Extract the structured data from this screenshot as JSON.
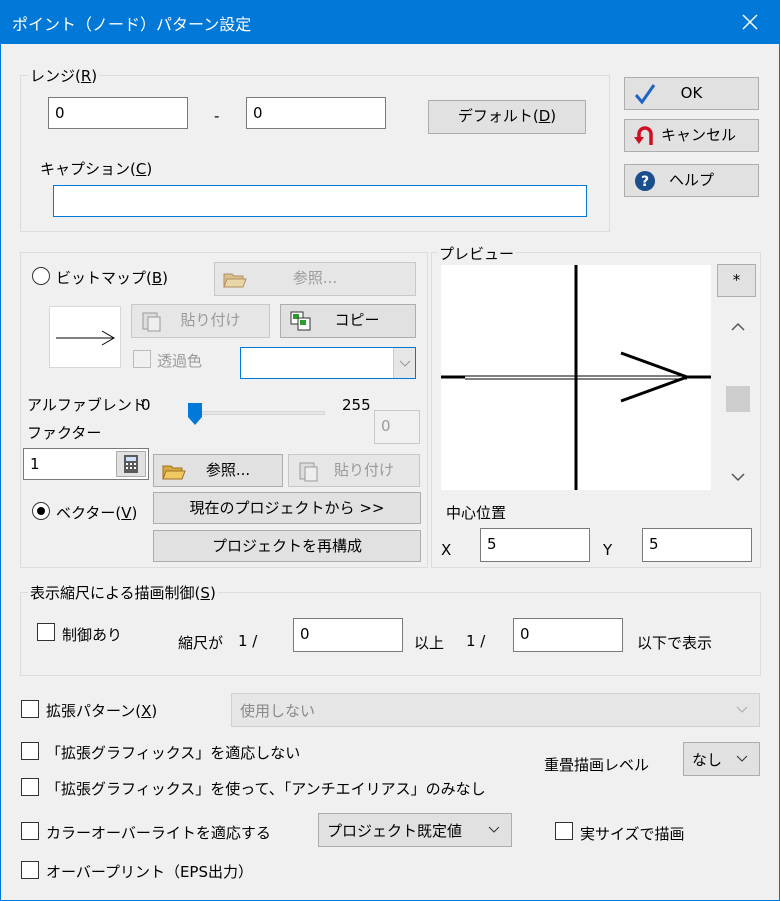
{
  "window": {
    "title": "ポイント（ノード）パターン設定"
  },
  "range": {
    "label": "レンジ(",
    "accel": "R",
    "label_end": ")",
    "from": "0",
    "dash": "-",
    "to": "0",
    "default_prefix": "デフォルト(",
    "default_accel": "D",
    "default_suffix": ")"
  },
  "caption": {
    "label": "キャプション(",
    "accel": "C",
    "label_end": ")",
    "value": ""
  },
  "actions": {
    "ok": "OK",
    "cancel": "キャンセル",
    "help": "ヘルプ"
  },
  "bitmap": {
    "radio_label": "ビットマップ(",
    "radio_accel": "B",
    "radio_end": ")",
    "browse": "参照...",
    "paste": "貼り付け",
    "copy": "コピー",
    "transparent": "透過色"
  },
  "alpha": {
    "label1": "アルファブレンド",
    "label2": "ファクター",
    "min": "0",
    "max": "255",
    "value_box": "0",
    "value": 0,
    "factor": "1"
  },
  "vector": {
    "browse": "参照...",
    "paste": "貼り付け",
    "radio_label": "ベクター(",
    "radio_accel": "V",
    "radio_end": ")",
    "from_project": "現在のプロジェクトから >>",
    "rebuild": "プロジェクトを再構成"
  },
  "preview": {
    "label": "プレビュー",
    "star": "*",
    "center_label": "中心位置",
    "x_label": "X",
    "x_value": "5",
    "y_label": "Y",
    "y_value": "5"
  },
  "scale": {
    "group_label": "表示縮尺による描画制御(",
    "group_accel": "S",
    "group_end": ")",
    "control": "制御あり",
    "ratio_label": "縮尺が",
    "one1": "1 /",
    "v1": "0",
    "above": "以上",
    "one2": "1 /",
    "v2": "0",
    "below": "以下で表示"
  },
  "extended": {
    "label": "拡張パターン(",
    "accel": "X",
    "end": ")",
    "select": "使用しない"
  },
  "graphics": {
    "no_apply": "「拡張グラフィックス」を適応しない",
    "no_antialias": "「拡張グラフィックス」を使って、「アンチエイリアス」のみなし"
  },
  "overlap": {
    "label": "重畳描画レベル",
    "value": "なし"
  },
  "color": {
    "label": "カラーオーバーライトを適応する",
    "value": "プロジェクト既定値"
  },
  "actual": {
    "label": "実サイズで描画"
  },
  "overprint": {
    "label": "オーバープリント（EPS出力）"
  }
}
